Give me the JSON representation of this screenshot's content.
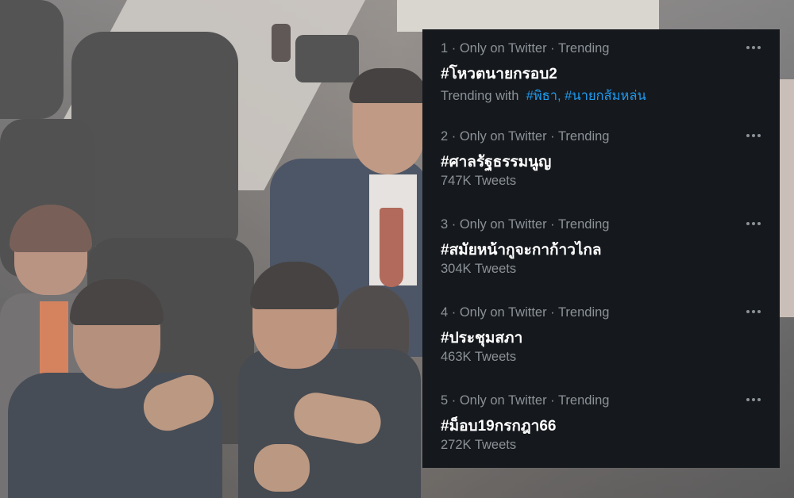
{
  "trends": [
    {
      "rank": "1",
      "context": " · Only on Twitter · Trending",
      "hashtag": "#โหวตนายกรอบ2",
      "trending_with_label": "Trending with",
      "trending_with": [
        "#พิธา",
        "#นายกส้มหล่น"
      ],
      "tweets": ""
    },
    {
      "rank": "2",
      "context": " · Only on Twitter · Trending",
      "hashtag": "#ศาลรัฐธรรมนูญ",
      "tweets": "747K Tweets"
    },
    {
      "rank": "3",
      "context": " · Only on Twitter · Trending",
      "hashtag": "#สมัยหน้ากูจะกาก้าวไกล",
      "tweets": "304K Tweets"
    },
    {
      "rank": "4",
      "context": " · Only on Twitter · Trending",
      "hashtag": "#ประชุมสภา",
      "tweets": "463K Tweets"
    },
    {
      "rank": "5",
      "context": " · Only on Twitter · Trending",
      "hashtag": "#ม็อบ19กรกฎา66",
      "tweets": "272K Tweets"
    }
  ],
  "colors": {
    "panel_bg": "#15181c",
    "text_primary": "#ffffff",
    "text_secondary": "#8b9298",
    "link": "#1d9bf0"
  },
  "icons": {
    "more": "more-horizontal-icon"
  }
}
